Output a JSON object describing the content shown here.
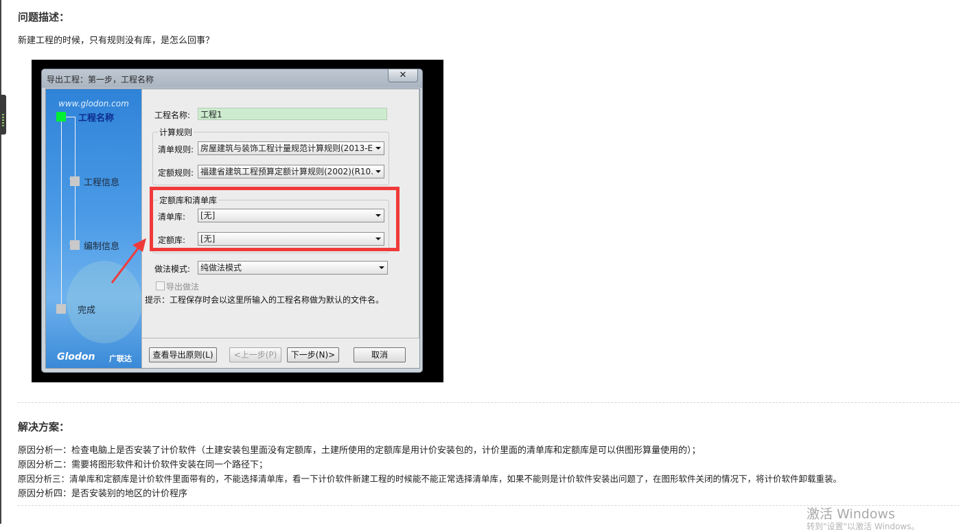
{
  "problem": {
    "heading": "问题描述：",
    "text": "新建工程的时候，只有规则没有库，是怎么回事？"
  },
  "dialog": {
    "title": "导出工程：第一步，工程名称",
    "close_label": "✕",
    "sidebar": {
      "url": "www.glodon.com",
      "steps": [
        "工程名称",
        "工程信息",
        "编制信息",
        "完成"
      ],
      "brand": "Glodon",
      "brand_cn": "广联达"
    },
    "form": {
      "project_name_label": "工程名称:",
      "project_name_value": "工程1",
      "calc_rules_title": "计算规则",
      "list_rule_label": "清单规则:",
      "list_rule_value": "房屋建筑与装饰工程计量规范计算规则(2013-E",
      "quota_rule_label": "定额规则:",
      "quota_rule_value": "福建省建筑工程预算定额计算规则(2002)(R10.",
      "library_title": "定额库和清单库",
      "list_lib_label": "清单库:",
      "list_lib_value": "[无]",
      "quota_lib_label": "定额库:",
      "quota_lib_value": "[无]",
      "method_mode_label": "做法模式:",
      "method_mode_value": "纯做法模式",
      "export_method_label": "导出做法",
      "hint": "提示：工程保存时会以这里所输入的工程名称做为默认的文件名。"
    },
    "buttons": {
      "view_rules": "查看导出原则(L)",
      "prev": "<上一步(P)",
      "next": "下一步(N)>",
      "cancel": "取消"
    }
  },
  "solution": {
    "heading": "解决方案：",
    "lines": [
      "原因分析一：检查电脑上是否安装了计价软件（土建安装包里面没有定额库，土建所使用的定额库是用计价安装包的，计价里面的清单库和定额库是可以供图形算量使用的）；",
      "原因分析二：需要将图形软件和计价软件安装在同一个路径下；",
      "原因分析三：清单库和定额库是计价软件里面带有的，不能选择清单库，看一下计价软件新建工程的时候能不能正常选择清单库，如果不能则是计价软件安装出问题了，在图形软件关闭的情况下，将计价软件卸载重装。",
      "原因分析四：是否安装别的地区的计价程序"
    ]
  },
  "os_watermark": {
    "line1": "激活 Windows",
    "line2": "转到\"设置\"以激活 Windows。"
  },
  "colors": {
    "highlight": "#f03a3a",
    "active_step": "#00ee33",
    "sidebar_blue": "#2f83d8"
  }
}
